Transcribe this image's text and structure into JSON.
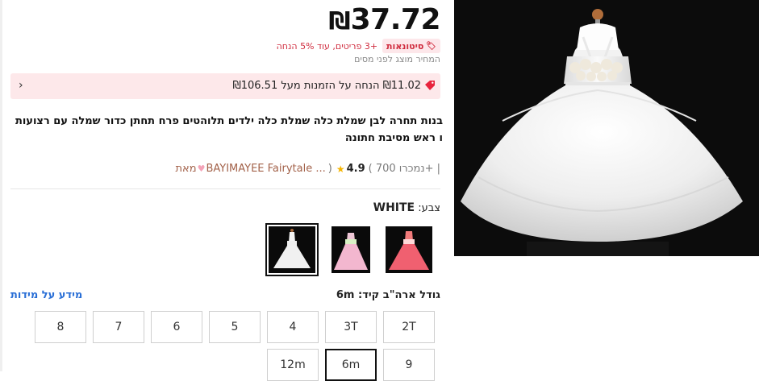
{
  "price": {
    "amount": "37.72",
    "currency": "₪"
  },
  "promo": {
    "badge_label": "סיטונאות",
    "text": "+3 פריטים, עוד 5% הנחה"
  },
  "tax_note": "המחיר מוצג לפני מסים",
  "coupon": {
    "text": "₪11.02 הנחה על הזמנות מעל ₪106.51"
  },
  "product": {
    "title": "בנות תחרה לבן שמלת כלה שמלת כלה ילדים תלוהטים פרח תחתן כדור שמלה עם רצועות ו ראש מסיבת חתונה"
  },
  "rating": {
    "score": "4.9",
    "sold_text": "( נמכרו 700+ |",
    "store_name": "BAYIMAYEE Fairytale ...",
    "from_label": "מאת",
    "close_paren": ")"
  },
  "color": {
    "label": "צבע:",
    "selected": "WHITE",
    "options": [
      "white",
      "pink",
      "coral"
    ]
  },
  "size": {
    "label": "גודל ארה\"ב קיד:",
    "selected": "6m",
    "guide_label": "מידע על מידות",
    "options_row1": [
      "2T",
      "3T",
      "4",
      "5",
      "6",
      "7",
      "8"
    ],
    "options_row2": [
      "9",
      "6m",
      "12m"
    ]
  },
  "colors": {
    "accent_red": "#d02d3f",
    "coupon_bg": "#fde8ea",
    "link_blue": "#2a6fd6",
    "star_yellow": "#f5b400"
  }
}
